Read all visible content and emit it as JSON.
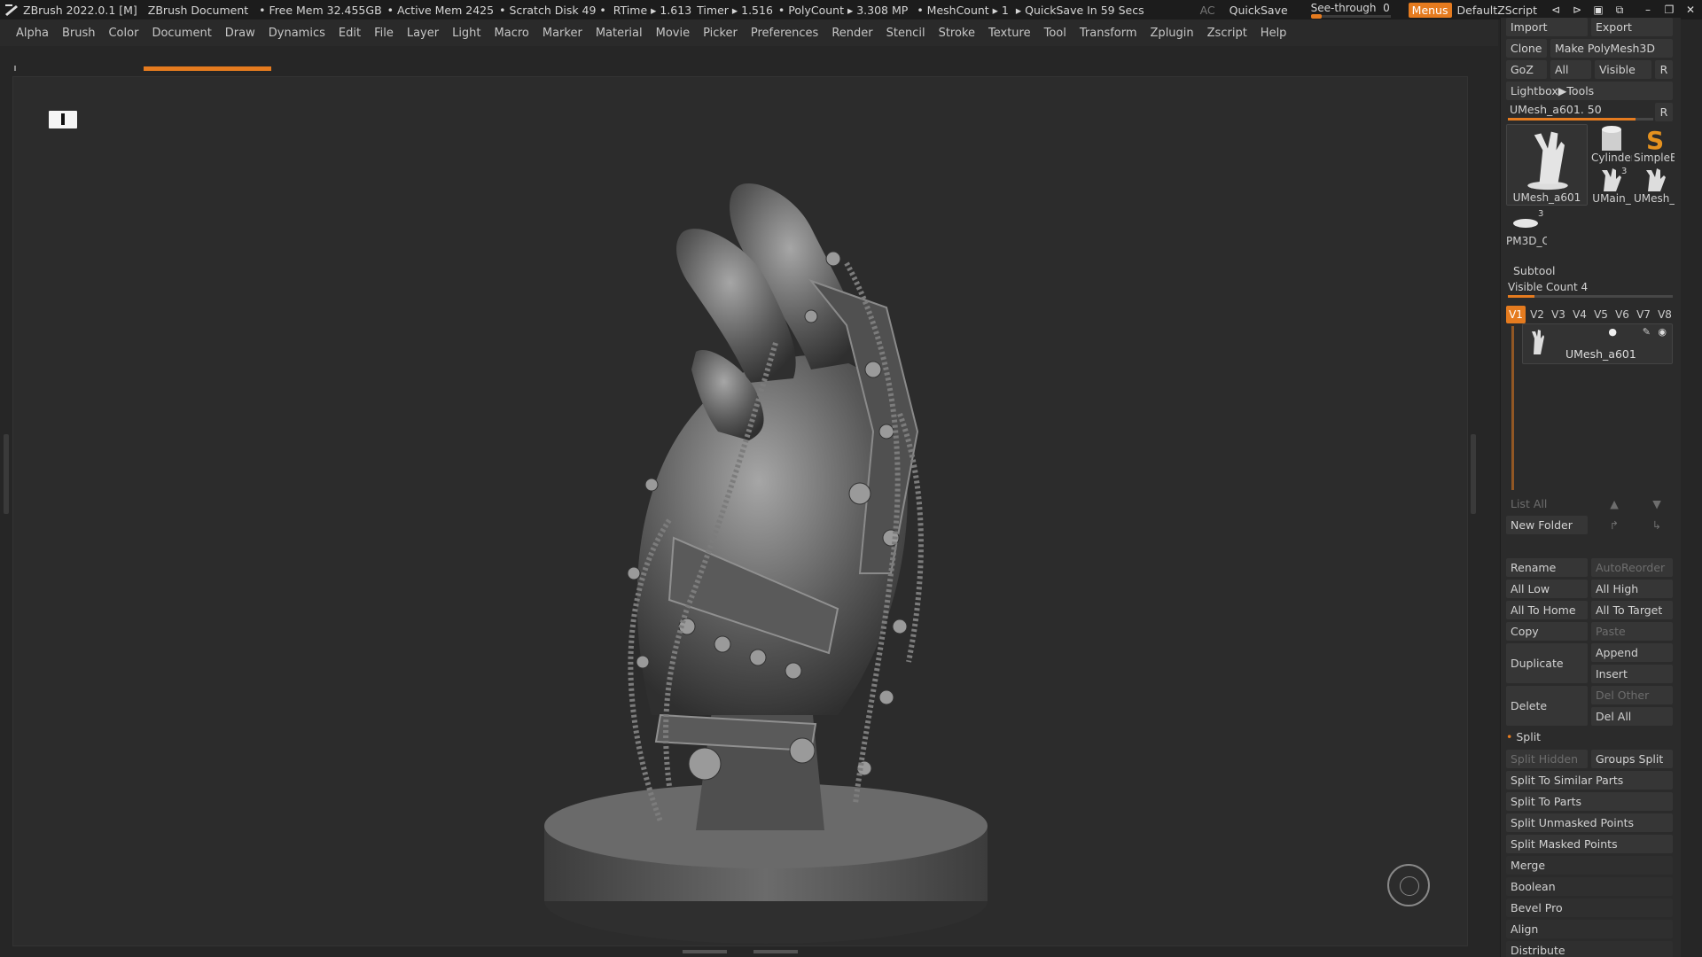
{
  "title_bar": {
    "app": "ZBrush 2022.0.1 [M]",
    "document": "ZBrush Document",
    "free_mem": "• Free Mem 32.455GB",
    "active_mem": "• Active Mem 2425",
    "scratch_disk": "• Scratch Disk 49 •",
    "rtime": "RTime ▸ 1.613",
    "timer": "Timer ▸ 1.516",
    "polycount": "• PolyCount ▸ 3.308 MP",
    "meshcount": "• MeshCount ▸ 1",
    "quicksave_status": "▸ QuickSave In 59 Secs",
    "ac": "AC",
    "quicksave": "QuickSave",
    "see_through_label": "See-through",
    "see_through_value": "0",
    "menus": "Menus",
    "script": "DefaultZScript"
  },
  "menu": [
    "Alpha",
    "Brush",
    "Color",
    "Document",
    "Draw",
    "Dynamics",
    "Edit",
    "File",
    "Layer",
    "Light",
    "Macro",
    "Marker",
    "Material",
    "Movie",
    "Picker",
    "Preferences",
    "Render",
    "Stencil",
    "Stroke",
    "Texture",
    "Tool",
    "Transform",
    "Zplugin",
    "Zscript",
    "Help"
  ],
  "tool_panel": {
    "import": "Import",
    "export": "Export",
    "clone": "Clone",
    "make_polymesh": "Make PolyMesh3D",
    "goz": "GoZ",
    "all": "All",
    "visible": "Visible",
    "r": "R",
    "lightbox": "Lightbox▶Tools",
    "current_tool": "UMesh_a601. 50",
    "current_tool_slider": 0.88,
    "thumbs": {
      "main": "UMesh_a601",
      "cylinder": "Cylinder",
      "simpleb": "SimpleB",
      "umain": "UMain_",
      "umesh": "UMesh_",
      "pm3d": "PM3D_C",
      "count_umain": "3",
      "count_pm3d": "3"
    }
  },
  "subtool": {
    "header": "Subtool",
    "visible_count": "Visible Count 4",
    "visible_count_slider": 0.16,
    "tabs": [
      "V1",
      "V2",
      "V3",
      "V4",
      "V5",
      "V6",
      "V7",
      "V8"
    ],
    "item_name": "UMesh_a601",
    "list_all": "List All",
    "new_folder": "New Folder",
    "rename": "Rename",
    "autoreorder": "AutoReorder",
    "all_low": "All Low",
    "all_high": "All High",
    "all_to_home": "All To Home",
    "all_to_target": "All To Target",
    "copy": "Copy",
    "paste": "Paste",
    "duplicate": "Duplicate",
    "append": "Append",
    "insert": "Insert",
    "delete": "Delete",
    "del_other": "Del Other",
    "del_all": "Del All",
    "split": "Split",
    "split_hidden": "Split Hidden",
    "groups_split": "Groups Split",
    "split_similar": "Split To Similar Parts",
    "split_parts": "Split To Parts",
    "split_unmasked": "Split Unmasked Points",
    "split_masked": "Split Masked Points",
    "merge": "Merge",
    "boolean": "Boolean",
    "bevel_pro": "Bevel Pro",
    "align": "Align",
    "distribute": "Distribute"
  },
  "colors": {
    "accent": "#e57b1f",
    "panel": "#2b2b2b",
    "canvas": "#2c2c2c"
  }
}
